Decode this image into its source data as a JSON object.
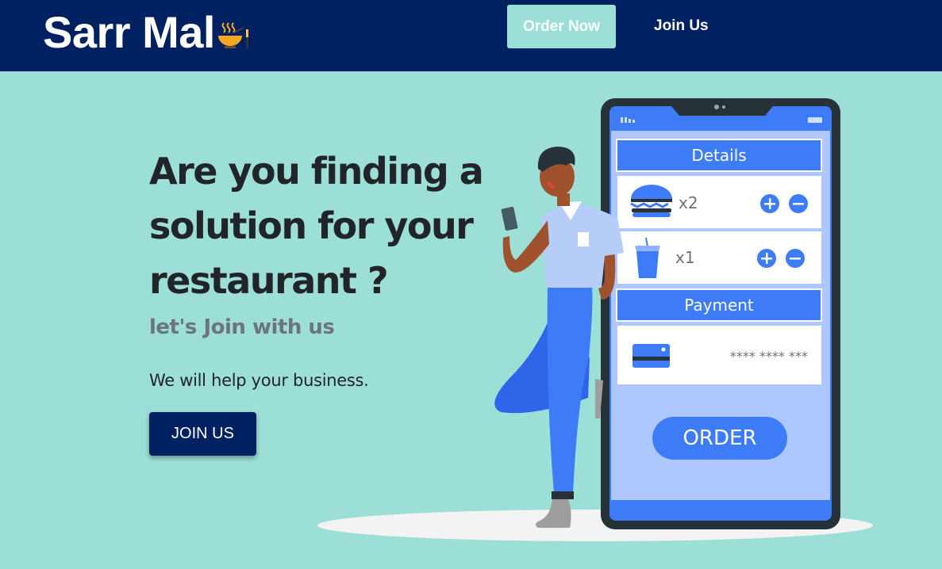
{
  "brand": {
    "name": "Sarr Mal",
    "logo_icon": "food-bowl-icon"
  },
  "nav": {
    "order_now": "Order Now",
    "join_us": "Join Us"
  },
  "hero": {
    "heading": "Are you finding a solution for your restaurant ?",
    "subheading": "let's Join with us",
    "text": "We will help your business.",
    "cta": "JOIN US"
  },
  "phone": {
    "details_label": "Details",
    "items": [
      {
        "icon": "burger-icon",
        "qty": "x2"
      },
      {
        "icon": "drink-cup-icon",
        "qty": "x1"
      }
    ],
    "payment_label": "Payment",
    "card_icon": "credit-card-icon",
    "card_number": "**** **** ***",
    "order_label": "ORDER"
  },
  "colors": {
    "navbar": "#002161",
    "background": "#9bdfd6",
    "accent_blue": "#3d7bf7",
    "phone_frame": "#263238"
  }
}
